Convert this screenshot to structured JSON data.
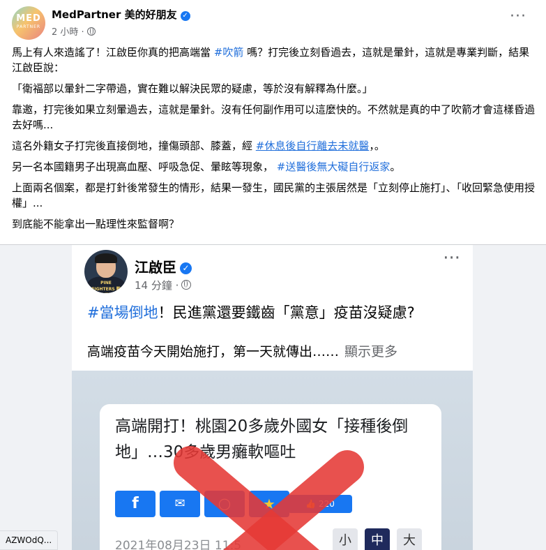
{
  "post": {
    "page_name": "MedPartner 美的好朋友",
    "time": "2 小時 ·",
    "avatar_text": "MED",
    "avatar_subtext": "PARTNER",
    "paragraphs": {
      "p1_a": "馬上有人來造謠了！江啟臣你真的把高端當 ",
      "p1_tag": "#吹箭",
      "p1_b": " 嗎？打完後立刻昏過去，這就是暈針，這就是專業判斷，結果江啟臣說：",
      "p2": "「衛福部以暈針二字帶過，實在難以解決民眾的疑慮，等於沒有解釋為什麼。」",
      "p3": "靠邀，打完後如果立刻暈過去，這就是暈針。沒有任何副作用可以這麼快的。不然就是真的中了吹箭才會這樣昏過去好嗎...",
      "p4_a": "這名外籍女子打完後直接倒地，撞傷頭部、膝蓋，經 ",
      "p4_tag": "#休息後自行離去未就醫",
      "p4_b": "，。",
      "p5_a": "另一名本國籍男子出現高血壓、呼吸急促、暈眩等現象， ",
      "p5_tag": "#送醫後無大礙自行返家",
      "p5_b": "。",
      "p6": "上面兩名個案，都是打針後常發生的情形，結果一發生，國民黨的主張居然是「立刻停止施打」、「收回緊急使用授權」...",
      "p7": "到底能不能拿出一點理性來監督啊？"
    }
  },
  "shared": {
    "name": "江啟臣",
    "time": "14 分鐘 ·",
    "avatar_badge": "PINE FIGHTERS 戰鬥隊",
    "headline_tag": "#當場倒地",
    "headline_rest": "！民進黨還要鐵齒「黨意」疫苗沒疑慮?",
    "summary": "高端疫苗今天開始施打，第一天就傳出……",
    "see_more": "顯示更多",
    "news": {
      "title": "高端開打！桃園20多歲外國女「接種後倒地」…30多歲男癱軟嘔吐",
      "like_count": "220",
      "date": "2021年08月23日 11:5",
      "size_small": "小",
      "size_medium": "中",
      "size_large": "大"
    }
  },
  "url_tooltip": "AZWOdQ...",
  "colors": {
    "link": "#216fdb",
    "facebook_blue": "#1877f2",
    "x_mark": "#e53935"
  },
  "icons": [
    "verified-badge-icon",
    "globe-icon",
    "more-options-icon",
    "facebook-icon",
    "messenger-icon",
    "line-icon",
    "bookmark-star-icon",
    "thumbs-up-icon"
  ]
}
